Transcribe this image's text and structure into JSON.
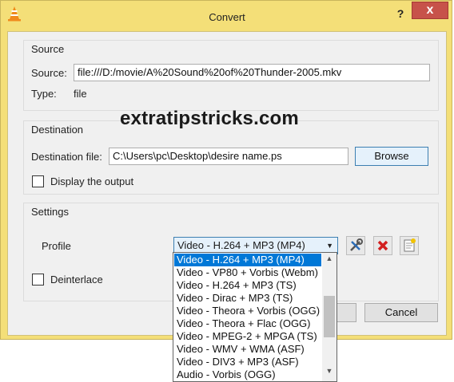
{
  "window": {
    "title": "Convert",
    "help": "?",
    "close": "x"
  },
  "source": {
    "group_title": "Source",
    "source_label": "Source:",
    "source_value": "file:///D:/movie/A%20Sound%20of%20Thunder-2005.mkv",
    "type_label": "Type:",
    "type_value": "file"
  },
  "watermark": "extratipstricks.com",
  "destination": {
    "group_title": "Destination",
    "file_label": "Destination file:",
    "file_value": "C:\\Users\\pc\\Desktop\\desire name.ps",
    "browse_label": "Browse",
    "display_output_label": "Display the output",
    "display_output_checked": false
  },
  "settings": {
    "group_title": "Settings",
    "profile_label": "Profile",
    "profile_selected": "Video - H.264 + MP3 (MP4)",
    "deinterlace_label": "Deinterlace",
    "deinterlace_checked": false,
    "profile_options": [
      "Video - H.264 + MP3 (MP4)",
      "Video - VP80 + Vorbis (Webm)",
      "Video - H.264 + MP3 (TS)",
      "Video - Dirac + MP3 (TS)",
      "Video - Theora + Vorbis (OGG)",
      "Video - Theora + Flac (OGG)",
      "Video - MPEG-2 + MPGA (TS)",
      "Video - WMV + WMA (ASF)",
      "Video - DIV3 + MP3 (ASF)",
      "Audio - Vorbis (OGG)"
    ],
    "tools": [
      "wrench-screwdriver-icon",
      "delete-icon",
      "new-profile-icon"
    ]
  },
  "footer": {
    "cancel_label": "Cancel"
  },
  "colors": {
    "window_frame": "#f4df78",
    "close_button": "#c7524a",
    "selection": "#0078d7",
    "focus_border": "#3c7fb1"
  }
}
